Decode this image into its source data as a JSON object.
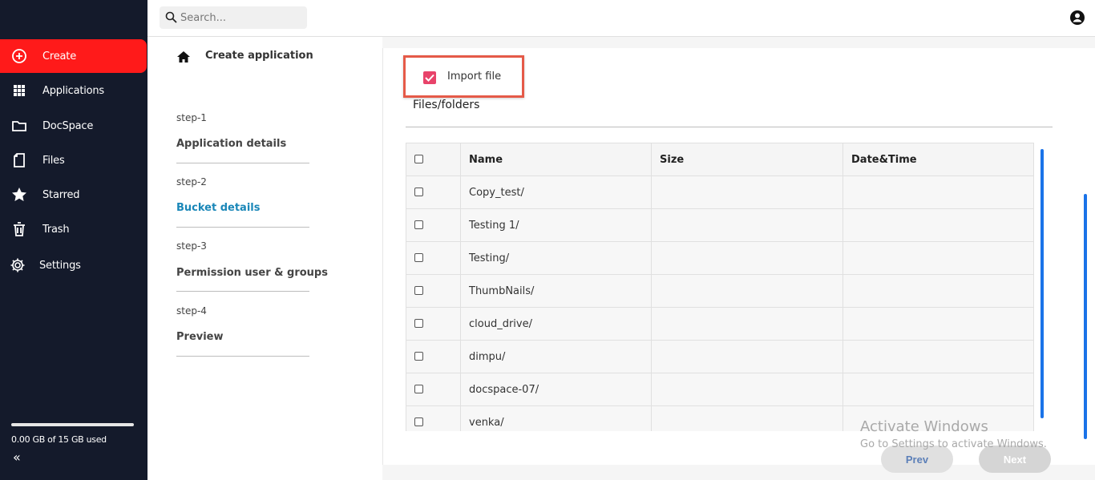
{
  "sidebar": {
    "items": [
      {
        "label": "Create",
        "icon": "plus-circle-icon",
        "active": true
      },
      {
        "label": "Applications",
        "icon": "grid-icon"
      },
      {
        "label": "DocSpace",
        "icon": "folder-icon"
      },
      {
        "label": "Files",
        "icon": "file-icon"
      },
      {
        "label": "Starred",
        "icon": "star-icon"
      },
      {
        "label": "Trash",
        "icon": "trash-icon"
      },
      {
        "label": "Settings",
        "icon": "gear-icon"
      }
    ],
    "storage_used": 0.0,
    "storage_text": "0.00 GB of 15 GB used",
    "collapse_glyph": "«"
  },
  "header": {
    "search_placeholder": "Search..."
  },
  "steps": {
    "title": "Create application",
    "items": [
      {
        "no": "step-1",
        "title": "Application details"
      },
      {
        "no": "step-2",
        "title": "Bucket details",
        "current": true
      },
      {
        "no": "step-3",
        "title": "Permission user & groups"
      },
      {
        "no": "step-4",
        "title": "Preview"
      }
    ]
  },
  "main": {
    "import_label": "Import file",
    "import_checked": true,
    "section_title": "Files/folders",
    "columns": [
      "Name",
      "Size",
      "Date&Time"
    ],
    "rows": [
      {
        "name": "Copy_test/",
        "size": "",
        "date": ""
      },
      {
        "name": "Testing 1/",
        "size": "",
        "date": ""
      },
      {
        "name": "Testing/",
        "size": "",
        "date": ""
      },
      {
        "name": "ThumbNails/",
        "size": "",
        "date": ""
      },
      {
        "name": "cloud_drive/",
        "size": "",
        "date": ""
      },
      {
        "name": "dimpu/",
        "size": "",
        "date": ""
      },
      {
        "name": "docspace-07/",
        "size": "",
        "date": ""
      },
      {
        "name": "venka/",
        "size": "",
        "date": ""
      }
    ],
    "prev_label": "Prev",
    "next_label": "Next"
  },
  "watermark": {
    "line1": "Activate Windows",
    "line2": "Go to Settings to activate Windows."
  },
  "colors": {
    "sidebar_bg": "#141a2b",
    "active": "#ff1a1a",
    "accent": "#1a87b8",
    "checkbox": "#e8436a",
    "highlight": "#e55a48"
  }
}
